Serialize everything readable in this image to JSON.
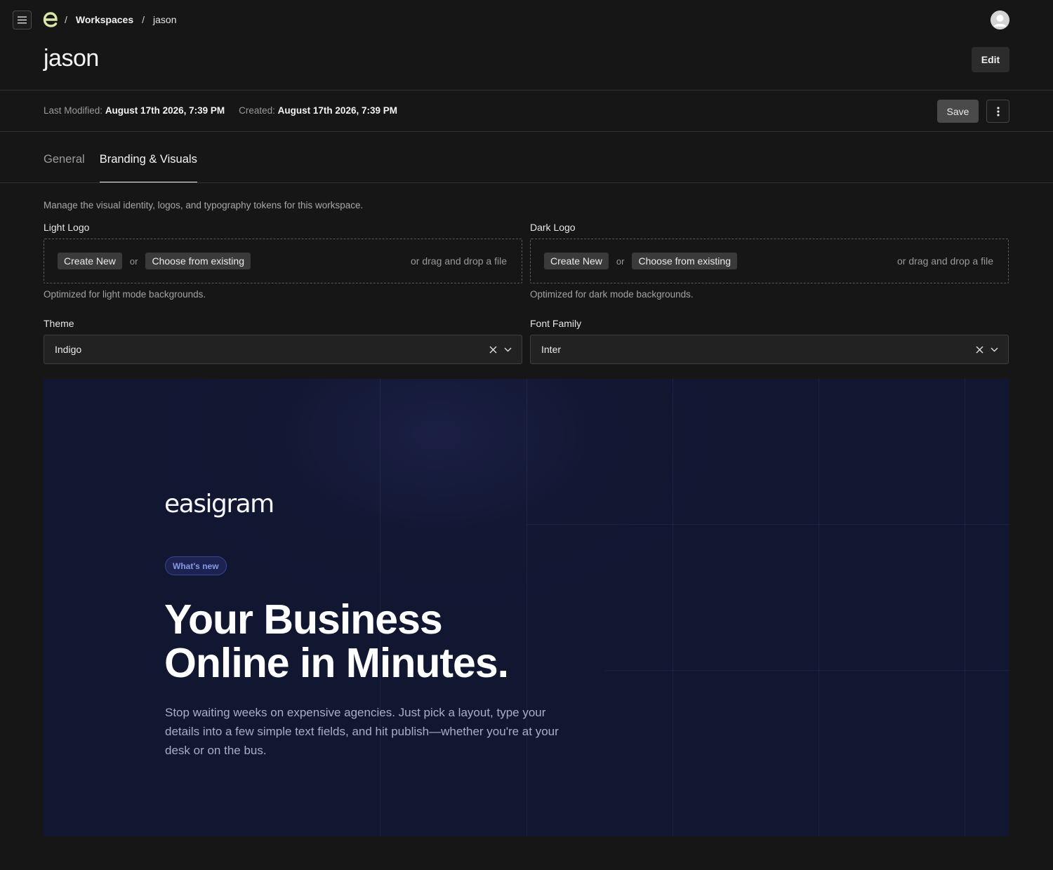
{
  "header": {
    "breadcrumbs": [
      "Workspaces",
      "jason"
    ],
    "menu_icon": "hamburger-icon",
    "logo_icon": "easigram-e-logo",
    "avatar_icon": "user-avatar-icon"
  },
  "page": {
    "title": "jason",
    "edit_label": "Edit"
  },
  "meta": {
    "last_modified_label": "Last Modified:",
    "last_modified_value": "August 17th 2026, 7:39 PM",
    "created_label": "Created:",
    "created_value": "August 17th 2026, 7:39 PM",
    "save_label": "Save",
    "more_icon": "vertical-dots-icon"
  },
  "tabs": [
    {
      "label": "General",
      "active": false
    },
    {
      "label": "Branding & Visuals",
      "active": true
    }
  ],
  "branding": {
    "description": "Manage the visual identity, logos, and typography tokens for this workspace.",
    "light_logo": {
      "label": "Light Logo",
      "create_label": "Create New",
      "or_label": "or",
      "choose_label": "Choose from existing",
      "drag_label": "or drag and drop a file",
      "hint": "Optimized for light mode backgrounds."
    },
    "dark_logo": {
      "label": "Dark Logo",
      "create_label": "Create New",
      "or_label": "or",
      "choose_label": "Choose from existing",
      "drag_label": "or drag and drop a file",
      "hint": "Optimized for dark mode backgrounds."
    },
    "theme": {
      "label": "Theme",
      "value": "Indigo"
    },
    "font_family": {
      "label": "Font Family",
      "value": "Inter"
    }
  },
  "preview": {
    "brand": "easigram",
    "badge": "What's new",
    "headline_line1": "Your Business",
    "headline_line2": "Online in Minutes.",
    "subtext": "Stop waiting weeks on expensive agencies. Just pick a layout, type your details into a few simple text fields, and hit publish—whether you're at your desk or on the bus.",
    "colors": {
      "background": "#111631",
      "badge_text": "#8a98e8"
    }
  },
  "colors": {
    "app_background": "#161616",
    "logo_accent": "#d8e6a6"
  }
}
